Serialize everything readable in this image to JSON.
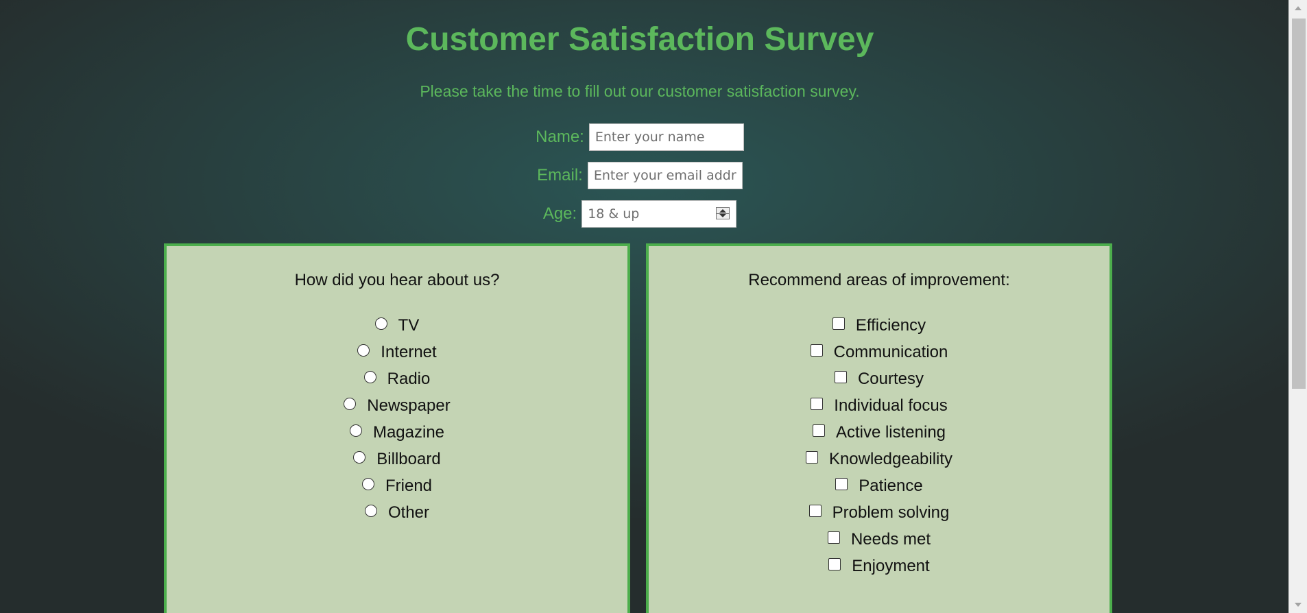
{
  "survey": {
    "title": "Customer Satisfaction Survey",
    "subtitle": "Please take the time to fill out our customer satisfaction survey."
  },
  "fields": {
    "name": {
      "label": "Name:",
      "placeholder": "Enter your name",
      "value": ""
    },
    "email": {
      "label": "Email:",
      "placeholder": "Enter your email address",
      "value": ""
    },
    "age": {
      "label": "Age:",
      "placeholder": "18 & up",
      "value": ""
    }
  },
  "hear_about": {
    "heading": "How did you hear about us?",
    "options": [
      "TV",
      "Internet",
      "Radio",
      "Newspaper",
      "Magazine",
      "Billboard",
      "Friend",
      "Other"
    ],
    "selected": null
  },
  "improvement": {
    "heading": "Recommend areas of improvement:",
    "options": [
      "Efficiency",
      "Communication",
      "Courtesy",
      "Individual focus",
      "Active listening",
      "Knowledgeability",
      "Patience",
      "Problem solving",
      "Needs met",
      "Enjoyment"
    ],
    "checked": []
  },
  "colors": {
    "accent": "#5cb85c",
    "panel_bg": "#c4d4b4",
    "panel_border": "#4cae4c",
    "page_bg_center": "#2b5554",
    "page_bg_edge": "#252d2d"
  },
  "icons": {
    "radio": "radio-button-icon",
    "checkbox": "checkbox-icon",
    "spinner": "number-spinner-icon",
    "scroll_up": "scroll-up-arrow-icon",
    "scroll_down": "scroll-down-arrow-icon"
  }
}
